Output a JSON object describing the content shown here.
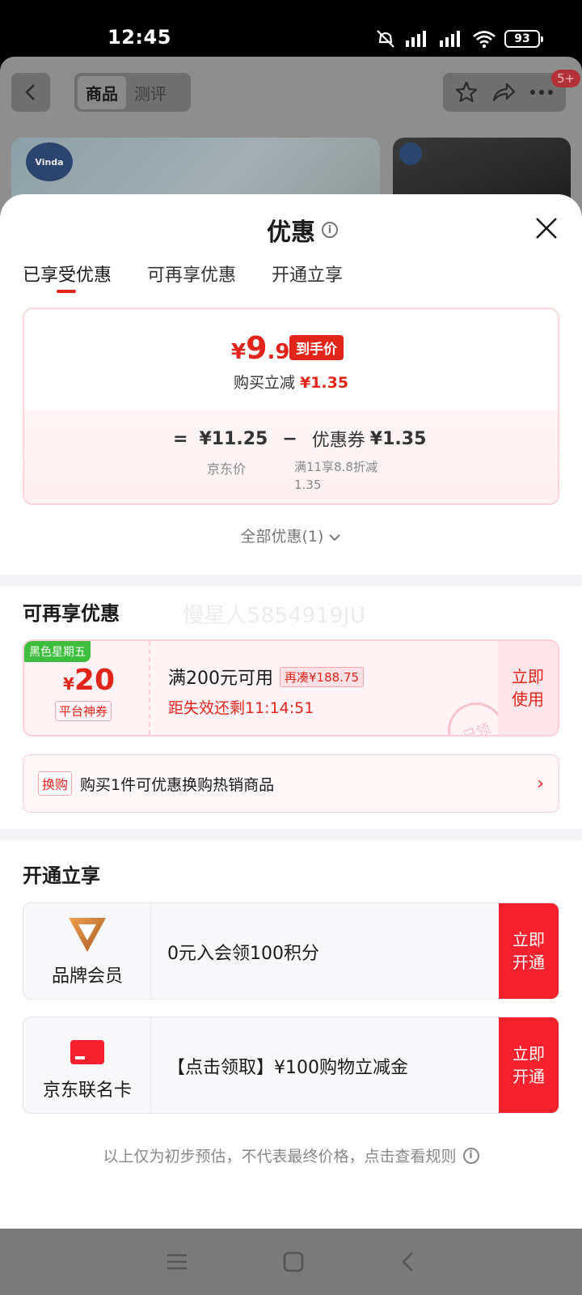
{
  "status_bar": {
    "time": "12:45",
    "battery": "93"
  },
  "background_page": {
    "tab_active": "商品",
    "tab_inactive": "测评",
    "badge": "5+",
    "brand_logo": "Vinda"
  },
  "sheet": {
    "title": "优惠",
    "tabs": [
      {
        "label": "已享受优惠"
      },
      {
        "label": "可再享优惠"
      },
      {
        "label": "开通立享"
      }
    ],
    "price_card": {
      "currency": "¥",
      "final_int": "9",
      "final_dec": ".9",
      "final_tag": "到手价",
      "reduce_label": "购买立减",
      "reduce_amount": "¥1.35",
      "eq_sign": "=",
      "jd_price": "¥11.25",
      "minus_sign": "−",
      "coupon_label": "优惠券",
      "coupon_amount": "¥1.35",
      "jd_price_label": "京东价",
      "coupon_desc": "满11享8.8折减1.35"
    },
    "all_discounts": "全部优惠(1)",
    "more_section": {
      "title": "可再享优惠",
      "watermark": "慢星人5854919JU",
      "coupon": {
        "tag": "黑色星期五",
        "currency": "¥",
        "value": "20",
        "type": "平台神券",
        "condition": "满200元可用",
        "pill": "再凑¥188.75",
        "timer": "距失效还剩11:14:51",
        "stamp": "已领",
        "action": "立即使用"
      },
      "exchange": {
        "tag": "换购",
        "text": "购买1件可优惠换购热销商品",
        "arrow": "›"
      }
    },
    "open_section": {
      "title": "开通立享",
      "items": [
        {
          "name": "品牌会员",
          "text": "0元入会领100积分",
          "action": "立即开通"
        },
        {
          "name": "京东联名卡",
          "text": "【点击领取】¥100购物立减金",
          "action": "立即开通"
        }
      ]
    },
    "disclaimer": "以上仅为初步预估，不代表最终价格，点击查看规则"
  },
  "colors": {
    "accent": "#e1251b",
    "green_tag": "#3dbf3d"
  },
  "icons": [
    "back-icon",
    "star-icon",
    "share-icon",
    "more-icon",
    "info-icon",
    "close-icon",
    "chevron-down-icon",
    "chevron-right-icon",
    "brand-v-icon",
    "card-icon",
    "menu-icon",
    "home-icon",
    "back-nav-icon"
  ]
}
